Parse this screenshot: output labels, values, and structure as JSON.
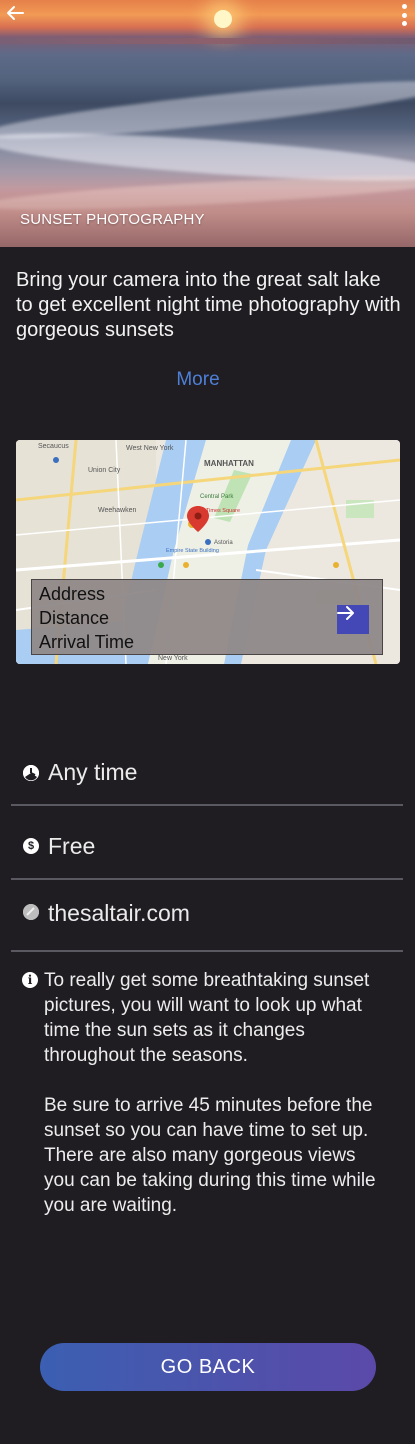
{
  "hero": {
    "title": "SUNSET PHOTOGRAPHY",
    "back_icon": "arrow-left-icon",
    "menu_icon": "more-vertical-icon"
  },
  "description": {
    "text": "Bring your camera into the great salt lake to get excellent night time photography with gorgeous sunsets",
    "more_label": "More"
  },
  "map": {
    "labels": [
      "Secaucus",
      "Union City",
      "Weehawken",
      "West New York",
      "MANHATTAN",
      "Central Park",
      "Times Square",
      "Empire State Building",
      "Astoria",
      "New York"
    ],
    "card": {
      "address_label": "Address",
      "distance_label": "Distance",
      "arrival_label": "Arrival Time",
      "go_icon": "arrow-right-icon"
    }
  },
  "details": {
    "time": {
      "icon": "clock-icon",
      "text": "Any time"
    },
    "price": {
      "icon": "dollar-icon",
      "text": "Free"
    },
    "website": {
      "icon": "globe-icon",
      "text": "thesaltair.com"
    }
  },
  "notes": {
    "icon": "info-icon",
    "paragraph1": "To really get some breathtaking sunset pictures, you will want to look up what time the sun sets as it changes throughout the seasons.",
    "paragraph2": "Be sure to arrive 45 minutes before the sunset so you can have time to set up.  There are also many gorgeous views you can be taking during this time while you are waiting."
  },
  "footer": {
    "go_back_label": "GO BACK"
  },
  "colors": {
    "background": "#1f1d22",
    "link": "#4e7fd6",
    "button_start": "#3b5fb2",
    "button_end": "#5b49a9",
    "map_go": "#4348b6"
  }
}
